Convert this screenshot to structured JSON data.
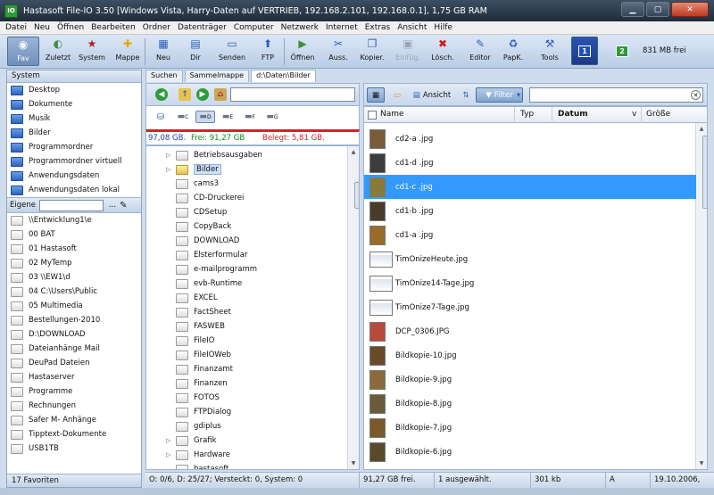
{
  "window": {
    "title": "Hastasoft File-IO 3.50  [Windows Vista, Harry-Daten auf VERTRIEB, 192.168.2.101, 192.168.0.1], 1,75 GB RAM",
    "app_icon_text": "IO"
  },
  "menu": [
    "Datei",
    "Neu",
    "Öffnen",
    "Bearbeiten",
    "Ordner",
    "Datenträger",
    "Computer",
    "Netzwerk",
    "Internet",
    "Extras",
    "Ansicht",
    "Hilfe"
  ],
  "toolbar": {
    "buttons": [
      {
        "label": "Fav",
        "icon": "favorites-icon",
        "glyph": "◉",
        "color": "#5a6e8c"
      },
      {
        "label": "Zuletzt",
        "icon": "recent-icon",
        "glyph": "◐",
        "color": "#3c8f3c"
      },
      {
        "label": "System",
        "icon": "system-icon",
        "glyph": "★",
        "color": "#b32020"
      },
      {
        "label": "Mappe",
        "icon": "mappe-icon",
        "glyph": "✚",
        "color": "#e2a800"
      },
      {
        "label": "Neu",
        "icon": "new-icon",
        "glyph": "▦",
        "color": "#2a5fb8"
      },
      {
        "label": "Dir",
        "icon": "dir-icon",
        "glyph": "▤",
        "color": "#2a5fb8"
      },
      {
        "label": "Senden",
        "icon": "send-icon",
        "glyph": "▭",
        "color": "#2a5fb8"
      },
      {
        "label": "FTP",
        "icon": "ftp-icon",
        "glyph": "⬆",
        "color": "#2a5fb8"
      },
      {
        "label": "Öffnen",
        "icon": "open-icon",
        "glyph": "▶",
        "color": "#3c8f3c"
      },
      {
        "label": "Auss.",
        "icon": "cut-icon",
        "glyph": "✂",
        "color": "#2a5fb8"
      },
      {
        "label": "Kopier.",
        "icon": "copy-icon",
        "glyph": "❐",
        "color": "#2a5fb8"
      },
      {
        "label": "Einfüg.",
        "icon": "paste-icon",
        "glyph": "▣",
        "color": "#9aa5b3"
      },
      {
        "label": "Lösch.",
        "icon": "delete-icon",
        "glyph": "✖",
        "color": "#d01818"
      },
      {
        "label": "Editor",
        "icon": "editor-icon",
        "glyph": "✎",
        "color": "#2a5fb8"
      },
      {
        "label": "PapK.",
        "icon": "recycle-bin-icon",
        "glyph": "♻",
        "color": "#2a5fb8"
      },
      {
        "label": "Tools",
        "icon": "tools-icon",
        "glyph": "⚒",
        "color": "#2a5fb8"
      }
    ],
    "drive1": "1",
    "drive2": "2",
    "free": "831 MB frei"
  },
  "left_panel": {
    "header": "System",
    "system_items": [
      "Desktop",
      "Dokumente",
      "Musik",
      "Bilder",
      "Programmordner",
      "Programmordner virtuell",
      "Anwendungsdaten",
      "Anwendungsdaten lokal"
    ],
    "eigene_label": "Eigene",
    "eigene_dots": "...",
    "eigene_items": [
      "\\\\Entwicklung1\\e",
      "00 BAT",
      "01 Hastasoft",
      "02 MyTemp",
      "03 \\\\EW1\\d",
      "04 C:\\Users\\Public",
      "05 Multimedia",
      "Bestellungen-2010",
      "D:\\DOWNLOAD",
      "Dateianhänge Mail",
      "DeuPad Dateien",
      "Hastaserver",
      "Programme",
      "Rechnungen",
      "Safer M- Anhänge",
      "Tipptext-Dokumente",
      "USB1TB"
    ],
    "footer": "17 Favoriten"
  },
  "tabs": [
    "Suchen",
    "Sammelmappe",
    "d:\\Daten\\Bilder"
  ],
  "drive_usage": {
    "total": "97,08 GB.",
    "free": "Frei: 91,27 GB",
    "used": "Belegt: 5,81 GB."
  },
  "drives": [
    "C",
    "D",
    "E",
    "F",
    "G"
  ],
  "tree": [
    {
      "label": "Betriebsausgaben",
      "arrow": true
    },
    {
      "label": "Bilder",
      "arrow": true,
      "selected": true
    },
    {
      "label": "cams3",
      "arrow": false
    },
    {
      "label": "CD-Druckerei",
      "arrow": false
    },
    {
      "label": "CDSetup",
      "arrow": false
    },
    {
      "label": "CopyBack",
      "arrow": false
    },
    {
      "label": "DOWNLOAD",
      "arrow": false
    },
    {
      "label": "Elsterformular",
      "arrow": false
    },
    {
      "label": "e-mailprogramm",
      "arrow": false
    },
    {
      "label": "evb-Runtime",
      "arrow": false
    },
    {
      "label": "EXCEL",
      "arrow": false
    },
    {
      "label": "FactSheet",
      "arrow": false
    },
    {
      "label": "FASWEB",
      "arrow": false
    },
    {
      "label": "FileIO",
      "arrow": false
    },
    {
      "label": "FileIOWeb",
      "arrow": false
    },
    {
      "label": "Finanzamt",
      "arrow": false
    },
    {
      "label": "Finanzen",
      "arrow": false
    },
    {
      "label": "FOTOS",
      "arrow": false
    },
    {
      "label": "FTPDialog",
      "arrow": false
    },
    {
      "label": "gdiplus",
      "arrow": false
    },
    {
      "label": "Grafik",
      "arrow": true
    },
    {
      "label": "Hardware",
      "arrow": true
    },
    {
      "label": "hastasoft",
      "arrow": false
    }
  ],
  "right_toolbar": {
    "ansicht": "Ansicht",
    "filter": "Filter"
  },
  "columns": {
    "name": "Name",
    "typ": "Typ",
    "datum": "Datum",
    "sort": "v",
    "groesse": "Größe"
  },
  "files": [
    {
      "name": "cd2-a .jpg",
      "thumb": "#7a5b3a",
      "wide": false
    },
    {
      "name": "cd1-d .jpg",
      "thumb": "#3d3d3d",
      "wide": false
    },
    {
      "name": "cd1-c .jpg",
      "thumb": "#8a7a3a",
      "wide": false,
      "selected": true
    },
    {
      "name": "cd1-b .jpg",
      "thumb": "#4a3b2a",
      "wide": false
    },
    {
      "name": "cd1-a .jpg",
      "thumb": "#9a6b2a",
      "wide": false
    },
    {
      "name": "TimOnizeHeute.jpg",
      "thumb": "#dfe6ee",
      "wide": true
    },
    {
      "name": "TimOnize14-Tage.jpg",
      "thumb": "#dfe6ee",
      "wide": true
    },
    {
      "name": "TimOnize7-Tage.jpg",
      "thumb": "#dfe6ee",
      "wide": true
    },
    {
      "name": "DCP_0306.JPG",
      "thumb": "#b84a3a",
      "wide": false
    },
    {
      "name": "Bildkopie-10.jpg",
      "thumb": "#6b4a2a",
      "wide": false
    },
    {
      "name": "Bildkopie-9.jpg",
      "thumb": "#8a6a3a",
      "wide": false
    },
    {
      "name": "Bildkopie-8.jpg",
      "thumb": "#6a5a3a",
      "wide": false
    },
    {
      "name": "Bildkopie-7.jpg",
      "thumb": "#7a5a2a",
      "wide": false
    },
    {
      "name": "Bildkopie-6.jpg",
      "thumb": "#5a4a2a",
      "wide": false
    }
  ],
  "status": {
    "left": "O: 0/6, D: 25/27; Versteckt: 0, System: 0",
    "free": "91,27 GB frei.",
    "selected": "1 ausgewählt.",
    "size": "301 kb",
    "attr": "A",
    "date": "19.10.2006,"
  },
  "colors": {
    "selection": "#3399ff",
    "usage_bar": "#d8202a",
    "free_text": "#0f8a0f",
    "used_text": "#d8202a",
    "total_text": "#1a3fb0"
  }
}
